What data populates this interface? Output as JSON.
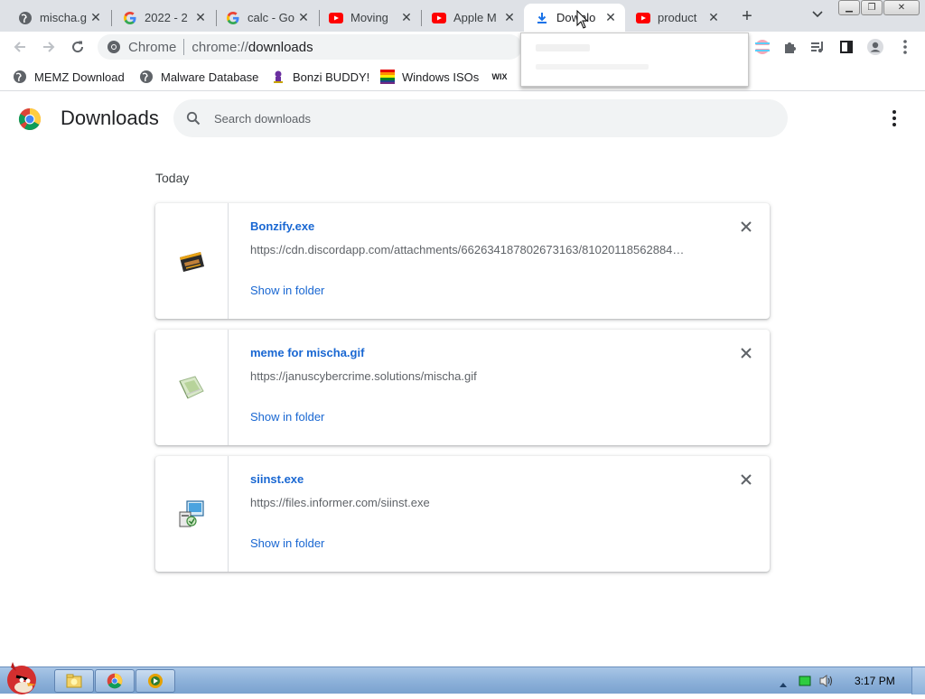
{
  "tabs": [
    {
      "title": "mischa.g",
      "icon": "globe-icon"
    },
    {
      "title": "2022 - 2",
      "icon": "google-icon"
    },
    {
      "title": "calc - Go",
      "icon": "google-icon"
    },
    {
      "title": "Moving",
      "icon": "youtube-icon"
    },
    {
      "title": "Apple M",
      "icon": "youtube-icon"
    },
    {
      "title": "Downlo",
      "icon": "download-icon"
    },
    {
      "title": "product",
      "icon": "youtube-icon"
    }
  ],
  "omnibox": {
    "chip": "Chrome",
    "url_prefix": "chrome://",
    "url_host": "downloads"
  },
  "bookmarks": [
    {
      "label": "MEMZ Download",
      "icon": "globe-icon"
    },
    {
      "label": "Malware Database",
      "icon": "globe-icon"
    },
    {
      "label": "Bonzi BUDDY!",
      "icon": "bonzi-icon"
    },
    {
      "label": "Windows ISOs",
      "icon": "rainbow-icon"
    },
    {
      "label": "wix-icon",
      "icon": "wix-icon"
    }
  ],
  "page": {
    "title": "Downloads",
    "search_placeholder": "Search downloads",
    "date_label": "Today"
  },
  "downloads": [
    {
      "name": "Bonzify.exe",
      "url": "https://cdn.discordapp.com/attachments/662634187802673163/81020118562884…",
      "action": "Show in folder",
      "icon": "exe-icon"
    },
    {
      "name": "meme for mischa.gif",
      "url": "https://januscybercrime.solutions/mischa.gif",
      "action": "Show in folder",
      "icon": "gif-file-icon"
    },
    {
      "name": "siinst.exe",
      "url": "https://files.informer.com/siinst.exe",
      "action": "Show in folder",
      "icon": "installer-icon"
    }
  ],
  "taskbar": {
    "clock": "3:17 PM"
  },
  "colors": {
    "link": "#1967d2",
    "tabstrip": "#dee1e6",
    "taskbar": "#8eb2da"
  }
}
